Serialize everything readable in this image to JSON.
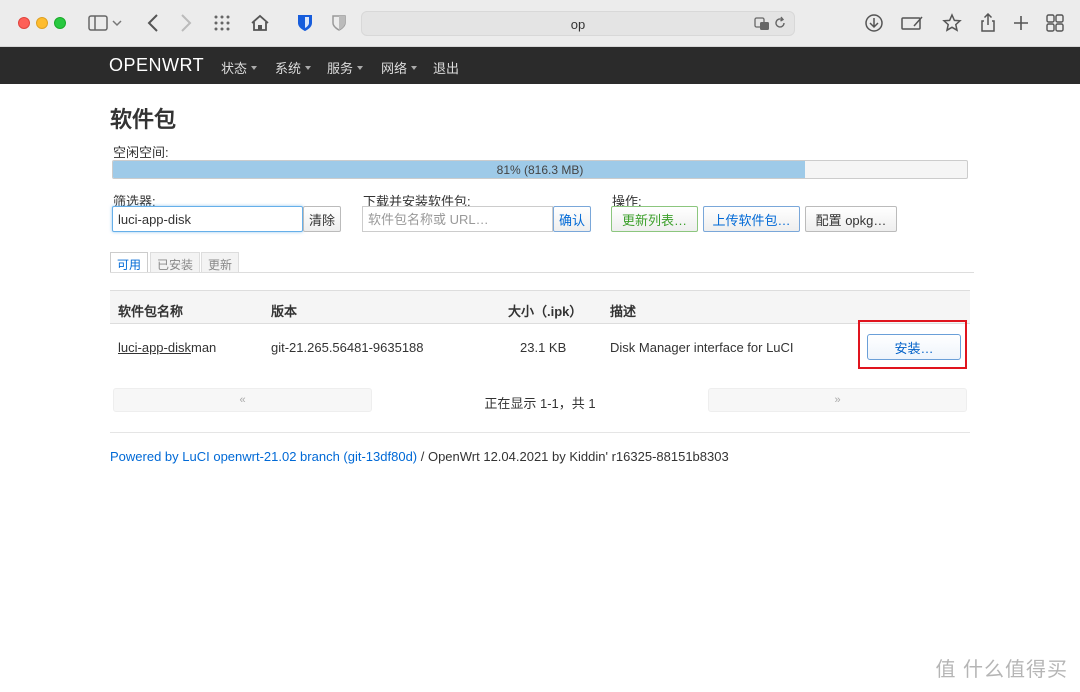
{
  "browser": {
    "address": "op"
  },
  "navbar": {
    "brand": "OPENWRT",
    "items": [
      {
        "label": "状态",
        "has_menu": true
      },
      {
        "label": "系统",
        "has_menu": true
      },
      {
        "label": "服务",
        "has_menu": true
      },
      {
        "label": "网络",
        "has_menu": true
      },
      {
        "label": "退出",
        "has_menu": false
      }
    ]
  },
  "page": {
    "title": "软件包",
    "free_space_label": "空闲空间:",
    "free_space_text": "81% (816.3 MB)",
    "free_space_fraction": 0.81
  },
  "filter": {
    "label": "筛选器:",
    "value": "luci-app-disk",
    "clear_label": "清除"
  },
  "download": {
    "label": "下载并安装软件包:",
    "placeholder": "软件包名称或 URL…",
    "confirm_label": "确认"
  },
  "actions": {
    "label": "操作:",
    "update_lists": "更新列表…",
    "upload_package": "上传软件包…",
    "configure_opkg": "配置 opkg…"
  },
  "tabs": [
    {
      "label": "可用",
      "active": true
    },
    {
      "label": "已安装",
      "active": false
    },
    {
      "label": "更新",
      "active": false
    }
  ],
  "table": {
    "headers": {
      "name": "软件包名称",
      "version": "版本",
      "size": "大小（.ipk）",
      "description": "描述"
    },
    "rows": [
      {
        "name_match": "luci-app-disk",
        "name_rest": "man",
        "version": "git-21.265.56481-9635188",
        "size": "23.1 KB",
        "description": "Disk Manager interface for LuCI",
        "action": "安装…"
      }
    ]
  },
  "pager": {
    "prev": "«",
    "status": "正在显示 1-1，共 1",
    "next": "»"
  },
  "footer": {
    "link": "Powered by LuCI openwrt-21.02 branch (git-13df80d)",
    "rest": " / OpenWrt 12.04.2021 by Kiddin' r16325-88151b8303"
  },
  "watermark": "值 什么值得买",
  "colors": {
    "highlight": "#e0141e",
    "navbar": "#2b2b2b",
    "progress_fill": "#9ecae8",
    "link": "#0069d6"
  }
}
